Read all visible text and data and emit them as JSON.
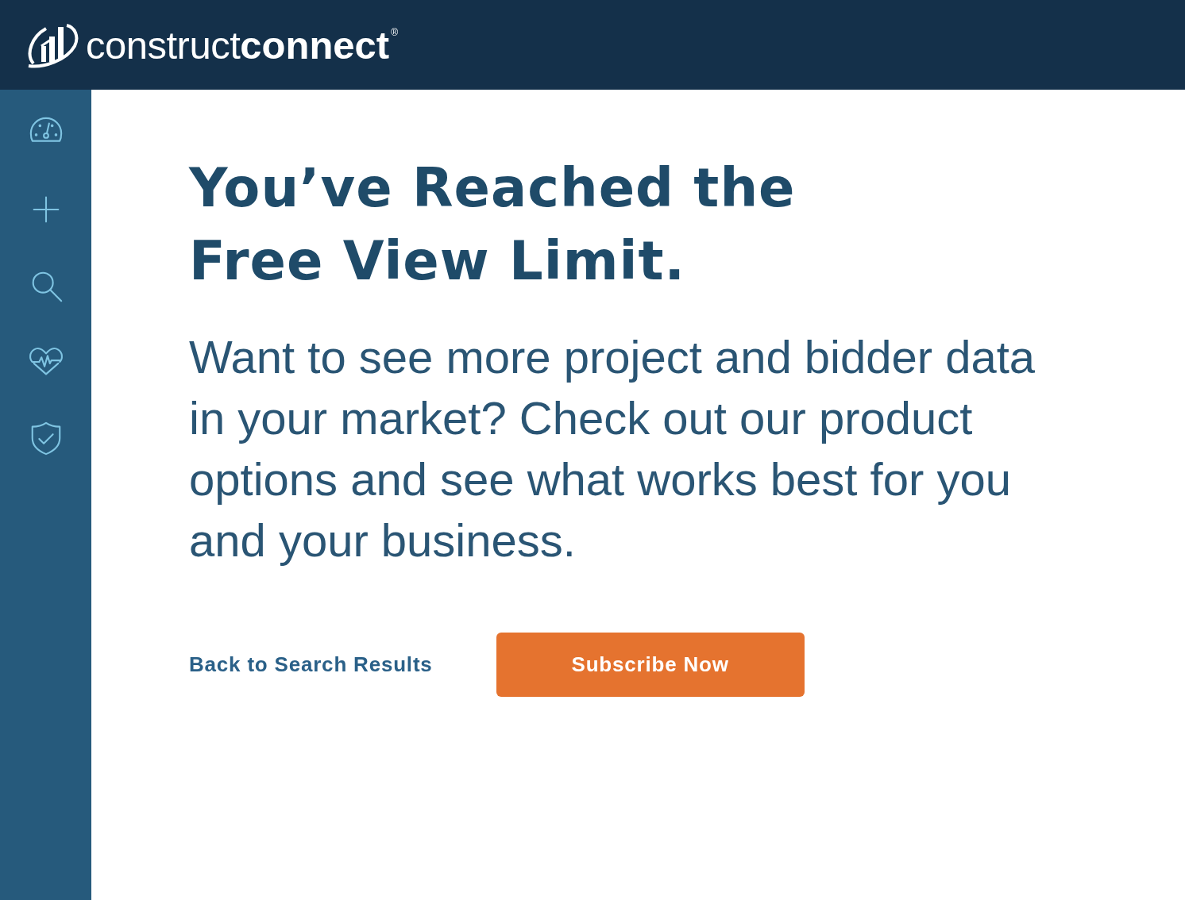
{
  "header": {
    "logo": "construct**connect**$^{®}$"
  },
  "message": {
    "title": "You’ve Reached the Free View Limit.",
    "body": "Want to see more project and bidder data in your market? Check out our product options and see what works best for you and your business."
  },
  "actions": {
    "link": "Back to Search Results",
    "button": "Subscribe Now"
  }
}
